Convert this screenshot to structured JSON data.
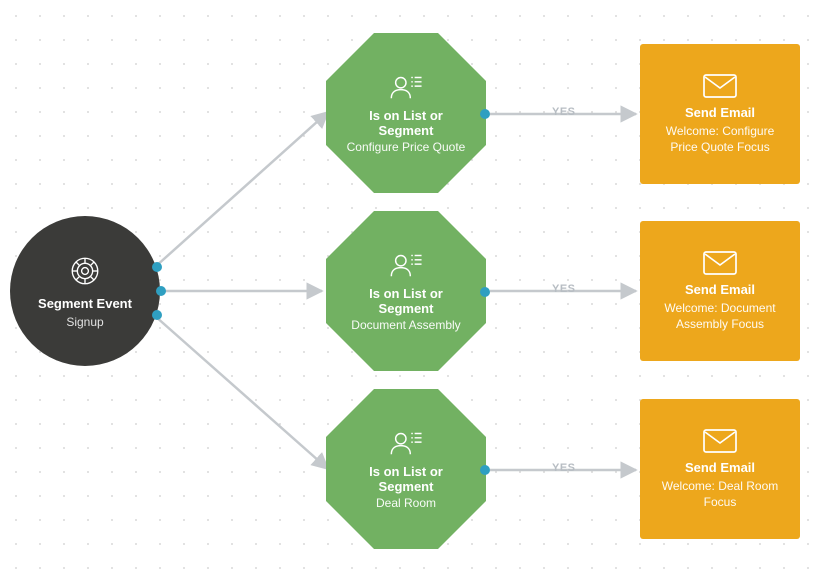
{
  "start": {
    "title": "Segment Event",
    "subtitle": "Signup"
  },
  "decisions": [
    {
      "title": "Is on List or Segment",
      "subtitle": "Configure Price Quote",
      "edge_label": "YES"
    },
    {
      "title": "Is on List or Segment",
      "subtitle": "Document Assembly",
      "edge_label": "YES"
    },
    {
      "title": "Is on List or Segment",
      "subtitle": "Deal Room",
      "edge_label": "YES"
    }
  ],
  "actions": [
    {
      "title": "Send Email",
      "subtitle": "Welcome: Configure Price Quote Focus"
    },
    {
      "title": "Send Email",
      "subtitle": "Welcome: Document Assembly Focus"
    },
    {
      "title": "Send Email",
      "subtitle": "Welcome: Deal Room Focus"
    }
  ],
  "colors": {
    "start": "#3b3b39",
    "decision": "#72b162",
    "action": "#eda71c",
    "connector": "#c5c9cd",
    "port": "#2f9fc1"
  }
}
